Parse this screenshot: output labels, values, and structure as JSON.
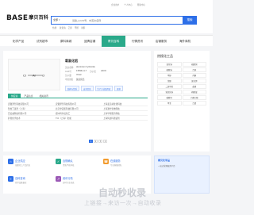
{
  "brand": {
    "logo": "BASE",
    "logo_cn": "摩贝百科"
  },
  "top_links": [
    "企业用户",
    "个人中心",
    "帮助中心"
  ],
  "search": {
    "category": "全部",
    "placeholder": "请输入CAS号、中英文名称",
    "button": "搜索"
  },
  "hot": [
    "热搜:",
    "氯化钠",
    "乙醇",
    "甲醇",
    "丙酮"
  ],
  "nav": [
    "化学产品",
    "试剂超市",
    "原料商城",
    "品牌店铺",
    "摩贝百科",
    "行情资讯",
    "店铺服务",
    "海外商机"
  ],
  "nav_active": 4,
  "product": {
    "name": "氧氯化铝",
    "rows": [
      {
        "k": "英文名称",
        "v": "aluminium hydroxide",
        "k2": "",
        "v2": ""
      },
      {
        "k": "CAS号",
        "v": "13596-11-7",
        "k2": "分子式",
        "v2": "AlClO"
      },
      {
        "k": "分子量",
        "v": "78.43",
        "k2": "",
        "v2": ""
      },
      {
        "k": "中文别名",
        "v": "氯氧化铝",
        "k2": "",
        "v2": ""
      }
    ],
    "tags": [
      "结构与性质",
      "安全信息",
      "生产方法及用途",
      "更多"
    ]
  },
  "tabs": [
    "供应商",
    "产品信息",
    "相关资讯"
  ],
  "suppliers": [
    [
      "安徽泽升科技有限公司",
      "安徽泽升科技有限公司",
      "上海麦克林生化科技"
    ],
    [
      "阿拉丁试剂（上海）",
      "北京伊诺凯科技有限公司",
      "上海源叶生物科技"
    ],
    [
      "百灵威科技有限公司",
      "郑州阿尔法化工",
      "上海毕得医药科技"
    ],
    [
      "萨恩化学技术",
      "TCI（上海）化成",
      "上海阿达玛斯试剂"
    ]
  ],
  "pager": [
    "1",
    "2",
    "3",
    "4"
  ],
  "side": {
    "title": "热搜化工品",
    "items": [
      "氯化钠",
      "硫酸铜",
      "碳酸钠",
      "乙醇",
      "甲醇",
      "丙酮",
      "苯酚",
      "氯化钾",
      "二氯甲烷",
      "盐酸",
      "氢氧化钠",
      "硝酸银",
      "碳酸钙",
      "乙酸乙酯",
      "甲苯",
      "乙腈"
    ]
  },
  "features": [
    {
      "title": "企业供应",
      "desc": "海量化工产品供应",
      "color": "#2d6fe8",
      "icon": "factory-icon"
    },
    {
      "title": "合规确认",
      "desc": "资质严格审核",
      "color": "#2aa98a",
      "icon": "shield-icon"
    },
    {
      "title": "在线服务",
      "desc": "专业客服团队",
      "color": "#f29b2e",
      "icon": "headset-icon"
    },
    {
      "title": "百科查询",
      "desc": "化学品数据库",
      "color": "#2d6fe8",
      "icon": "book-icon"
    },
    {
      "title": "资讯行情",
      "desc": "实时行业动态",
      "color": "#9b59b6",
      "icon": "chart-icon"
    }
  ],
  "ad": {
    "title": "摩贝化学品",
    "sub": "一站式采购服务平台"
  },
  "watermark": {
    "text": "自动秒收录",
    "sub": "上链接→来访一次→自动收录"
  }
}
